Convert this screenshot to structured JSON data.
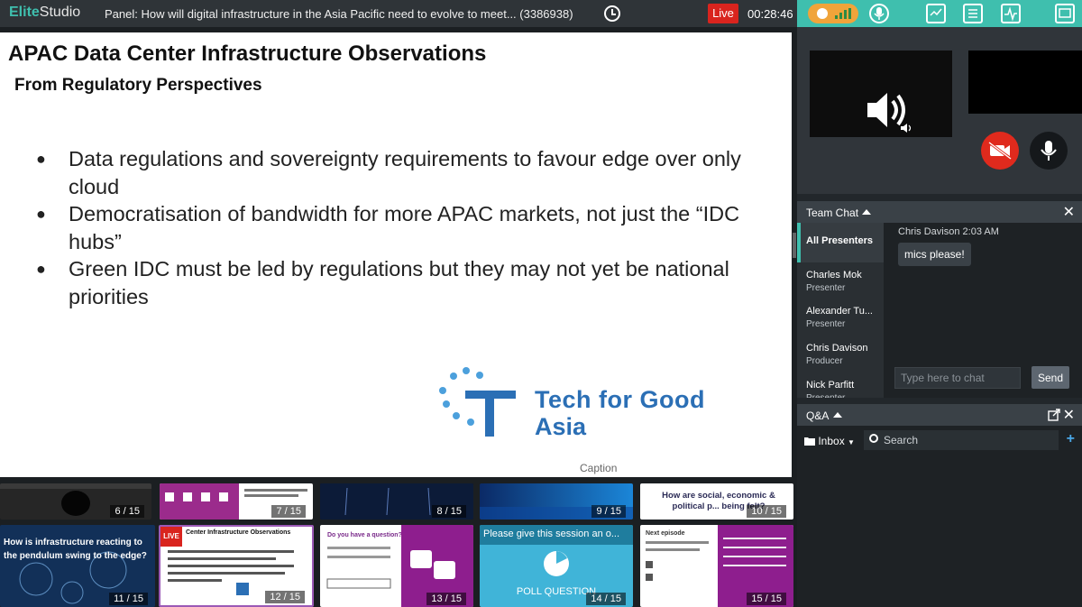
{
  "topbar": {
    "brand_bold": "Elite",
    "brand_light": "Studio",
    "panel_title": "Panel: How will digital infrastructure in the Asia Pacific need to evolve to meet... (3386938)",
    "live_label": "Live",
    "timer": "00:28:46",
    "icons": [
      "clock-icon",
      "signal-icon",
      "mic-icon",
      "presentation-icon",
      "document-icon",
      "activity-icon"
    ]
  },
  "slide": {
    "title": "APAC Data Center Infrastructure Observations",
    "subtitle": "From Regulatory Perspectives",
    "bullets": [
      "Data regulations and sovereignty requirements to favour edge over only cloud",
      "Democratisation of bandwidth for more APAC markets, not just the “IDC hubs”",
      "Green IDC must be led by regulations but they may not yet be national priorities"
    ],
    "logo_line1": "Tech for Good",
    "logo_line2": "Asia",
    "caption": "Caption",
    "logo_color": "#2b6fb5"
  },
  "thumbnails": [
    {
      "num": "6 / 15"
    },
    {
      "num": "7 / 15"
    },
    {
      "num": "8 / 15"
    },
    {
      "num": "9 / 15"
    },
    {
      "num": "10 / 15",
      "text": "How are social, economic & political p... being felt?"
    },
    {
      "num": "11 / 15",
      "text": "How is infrastructure reacting to the pendulum swing to the edge?"
    },
    {
      "num": "12 / 15",
      "text": "Center Infrastructure Observations",
      "badge": "LIVE"
    },
    {
      "num": "13 / 15",
      "text": "Do you have a question?"
    },
    {
      "num": "14 / 15",
      "text": "Please give this session an o...",
      "sub": "POLL QUESTION"
    },
    {
      "num": "15 / 15",
      "text": "Next episode"
    }
  ],
  "team_chat": {
    "title": "Team Chat",
    "members": [
      {
        "name": "All Presenters",
        "role": ""
      },
      {
        "name": "Charles Mok",
        "role": "Presenter"
      },
      {
        "name": "Alexander Tu...",
        "role": "Presenter"
      },
      {
        "name": "Chris Davison",
        "role": "Producer"
      },
      {
        "name": "Nick Parfitt",
        "role": "Presenter"
      }
    ],
    "message_author": "Chris Davison",
    "message_time": "2:03 AM",
    "message_text": "mics please!",
    "input_placeholder": "Type here to chat",
    "send_label": "Send"
  },
  "qa": {
    "title": "Q&A",
    "inbox_label": "Inbox",
    "search_placeholder": "Search"
  },
  "colors": {
    "accent": "#3fbfae",
    "live": "#d9241e",
    "camera_off": "#e02a1d",
    "signal": "#f0a43a"
  }
}
